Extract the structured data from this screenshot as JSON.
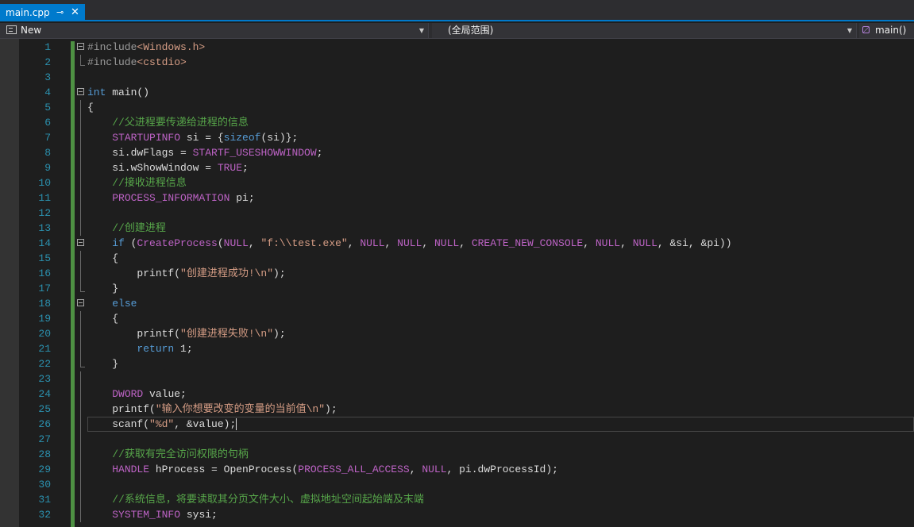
{
  "tab": {
    "filename": "main.cpp",
    "pin_glyph": "⊸",
    "close_glyph": "✕"
  },
  "navbar": {
    "project": "New",
    "scope": "(全局范围)",
    "function": "main()"
  },
  "editor": {
    "current_line": 26,
    "lines": [
      {
        "n": "1",
        "fold": "open",
        "tokens": [
          [
            "pp",
            "#include"
          ],
          [
            "st",
            "<Windows.h>"
          ]
        ]
      },
      {
        "n": "2",
        "guide": "end",
        "tokens": [
          [
            "pp",
            "#include"
          ],
          [
            "st",
            "<cstdio>"
          ]
        ]
      },
      {
        "n": "3",
        "tokens": []
      },
      {
        "n": "4",
        "fold": "open",
        "tokens": [
          [
            "kw",
            "int"
          ],
          [
            "fn",
            " main()"
          ]
        ]
      },
      {
        "n": "5",
        "guide": "line",
        "tokens": [
          [
            "fn",
            "{"
          ]
        ]
      },
      {
        "n": "6",
        "guide": "line",
        "tokens": [
          [
            "fn",
            "    "
          ],
          [
            "cm",
            "//父进程要传递给进程的信息"
          ]
        ]
      },
      {
        "n": "7",
        "guide": "line",
        "tokens": [
          [
            "fn",
            "    "
          ],
          [
            "mc",
            "STARTUPINFO"
          ],
          [
            "fn",
            " si = {"
          ],
          [
            "kw",
            "sizeof"
          ],
          [
            "fn",
            "(si)};"
          ]
        ]
      },
      {
        "n": "8",
        "guide": "line",
        "tokens": [
          [
            "fn",
            "    si.dwFlags = "
          ],
          [
            "mc",
            "STARTF_USESHOWWINDOW"
          ],
          [
            "fn",
            ";"
          ]
        ]
      },
      {
        "n": "9",
        "guide": "line",
        "tokens": [
          [
            "fn",
            "    si.wShowWindow = "
          ],
          [
            "mc",
            "TRUE"
          ],
          [
            "fn",
            ";"
          ]
        ]
      },
      {
        "n": "10",
        "guide": "line",
        "tokens": [
          [
            "fn",
            "    "
          ],
          [
            "cm",
            "//接收进程信息"
          ]
        ]
      },
      {
        "n": "11",
        "guide": "line",
        "tokens": [
          [
            "fn",
            "    "
          ],
          [
            "mc",
            "PROCESS_INFORMATION"
          ],
          [
            "fn",
            " pi;"
          ]
        ]
      },
      {
        "n": "12",
        "guide": "line",
        "tokens": []
      },
      {
        "n": "13",
        "guide": "line",
        "tokens": [
          [
            "fn",
            "    "
          ],
          [
            "cm",
            "//创建进程"
          ]
        ]
      },
      {
        "n": "14",
        "fold": "open",
        "tokens": [
          [
            "fn",
            "    "
          ],
          [
            "kw",
            "if"
          ],
          [
            "fn",
            " ("
          ],
          [
            "mc",
            "CreateProcess"
          ],
          [
            "fn",
            "("
          ],
          [
            "mc",
            "NULL"
          ],
          [
            "fn",
            ", "
          ],
          [
            "st",
            "\"f:\\\\test.exe\""
          ],
          [
            "fn",
            ", "
          ],
          [
            "mc",
            "NULL"
          ],
          [
            "fn",
            ", "
          ],
          [
            "mc",
            "NULL"
          ],
          [
            "fn",
            ", "
          ],
          [
            "mc",
            "NULL"
          ],
          [
            "fn",
            ", "
          ],
          [
            "mc",
            "CREATE_NEW_CONSOLE"
          ],
          [
            "fn",
            ", "
          ],
          [
            "mc",
            "NULL"
          ],
          [
            "fn",
            ", "
          ],
          [
            "mc",
            "NULL"
          ],
          [
            "fn",
            ", &si, &pi))"
          ]
        ]
      },
      {
        "n": "15",
        "guide": "line",
        "tokens": [
          [
            "fn",
            "    {"
          ]
        ]
      },
      {
        "n": "16",
        "guide": "line",
        "tokens": [
          [
            "fn",
            "        printf("
          ],
          [
            "st",
            "\"创建进程成功!\\n\""
          ],
          [
            "fn",
            ");"
          ]
        ]
      },
      {
        "n": "17",
        "guide": "end",
        "tokens": [
          [
            "fn",
            "    }"
          ]
        ]
      },
      {
        "n": "18",
        "fold": "open",
        "tokens": [
          [
            "fn",
            "    "
          ],
          [
            "kw",
            "else"
          ]
        ]
      },
      {
        "n": "19",
        "guide": "line",
        "tokens": [
          [
            "fn",
            "    {"
          ]
        ]
      },
      {
        "n": "20",
        "guide": "line",
        "tokens": [
          [
            "fn",
            "        printf("
          ],
          [
            "st",
            "\"创建进程失败!\\n\""
          ],
          [
            "fn",
            ");"
          ]
        ]
      },
      {
        "n": "21",
        "guide": "line",
        "tokens": [
          [
            "fn",
            "        "
          ],
          [
            "kw",
            "return"
          ],
          [
            "fn",
            " 1;"
          ]
        ]
      },
      {
        "n": "22",
        "guide": "end",
        "tokens": [
          [
            "fn",
            "    }"
          ]
        ]
      },
      {
        "n": "23",
        "guide": "line",
        "tokens": []
      },
      {
        "n": "24",
        "guide": "line",
        "tokens": [
          [
            "fn",
            "    "
          ],
          [
            "mc",
            "DWORD"
          ],
          [
            "fn",
            " value;"
          ]
        ]
      },
      {
        "n": "25",
        "guide": "line",
        "tokens": [
          [
            "fn",
            "    printf("
          ],
          [
            "st",
            "\"输入你想要改变的变量的当前值\\n\""
          ],
          [
            "fn",
            ");"
          ]
        ]
      },
      {
        "n": "26",
        "guide": "line",
        "tokens": [
          [
            "fn",
            "    scanf("
          ],
          [
            "st",
            "\"%d\""
          ],
          [
            "fn",
            ", &value);"
          ]
        ]
      },
      {
        "n": "27",
        "guide": "line",
        "tokens": []
      },
      {
        "n": "28",
        "guide": "line",
        "tokens": [
          [
            "fn",
            "    "
          ],
          [
            "cm",
            "//获取有完全访问权限的句柄"
          ]
        ]
      },
      {
        "n": "29",
        "guide": "line",
        "tokens": [
          [
            "fn",
            "    "
          ],
          [
            "mc",
            "HANDLE"
          ],
          [
            "fn",
            " hProcess = OpenProcess("
          ],
          [
            "mc",
            "PROCESS_ALL_ACCESS"
          ],
          [
            "fn",
            ", "
          ],
          [
            "mc",
            "NULL"
          ],
          [
            "fn",
            ", pi.dwProcessId);"
          ]
        ]
      },
      {
        "n": "30",
        "guide": "line",
        "tokens": []
      },
      {
        "n": "31",
        "guide": "line",
        "tokens": [
          [
            "fn",
            "    "
          ],
          [
            "cm",
            "//系统信息，将要读取其分页文件大小、虚拟地址空间起始端及末端"
          ]
        ]
      },
      {
        "n": "32",
        "guide": "line",
        "tokens": [
          [
            "fn",
            "    "
          ],
          [
            "mc",
            "SYSTEM_INFO"
          ],
          [
            "fn",
            " sysi;"
          ]
        ]
      }
    ]
  },
  "colors": {
    "accent": "#007acc",
    "background": "#1e1e1e",
    "line_number": "#2b91af",
    "keyword": "#569cd6",
    "comment": "#57a64a",
    "string": "#d69d85",
    "macro": "#bd63c5",
    "change_bar": "#57a64a"
  }
}
